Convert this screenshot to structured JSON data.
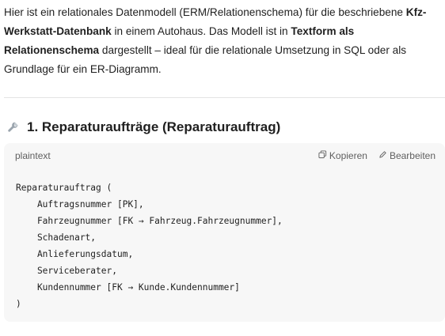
{
  "intro": {
    "t1": "Hier ist ein relationales Datenmodell (ERM/Relationenschema) für die beschriebene ",
    "b1": "Kfz-Werkstatt-Datenbank",
    "t2": " in einem Autohaus. Das Modell ist in ",
    "b2": "Textform als Relationenschema",
    "t3": " dargestellt – ideal für die relationale Umsetzung in SQL oder als Grundlage für ein ER-Diagramm."
  },
  "section": {
    "title": "1. Reparaturaufträge (Reparaturauftrag)",
    "icon": "wrench-icon"
  },
  "code_block": {
    "language": "plaintext",
    "copy_label": "Kopieren",
    "edit_label": "Bearbeiten",
    "lines": [
      "Reparaturauftrag (",
      "    Auftragsnummer [PK],",
      "    Fahrzeugnummer [FK → Fahrzeug.Fahrzeugnummer],",
      "    Schadenart,",
      "    Anlieferungsdatum,",
      "    Serviceberater,",
      "    Kundennummer [FK → Kunde.Kundennummer]",
      ")"
    ]
  }
}
